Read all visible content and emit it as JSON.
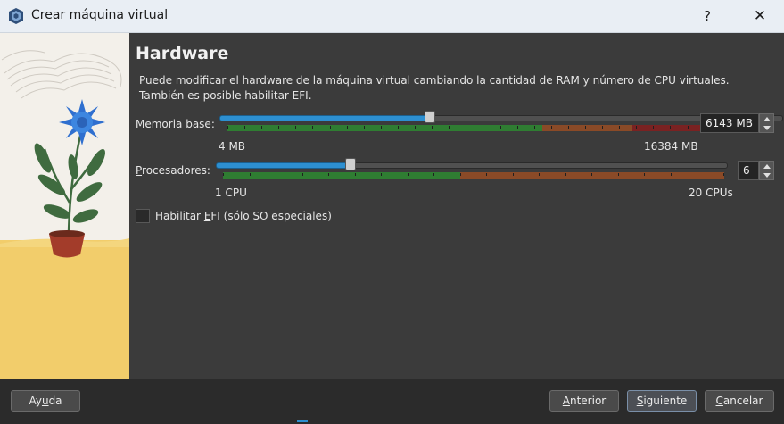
{
  "window": {
    "title": "Crear máquina virtual",
    "help": "?",
    "close": "✕"
  },
  "page": {
    "heading": "Hardware",
    "description_line1": "Puede modificar el hardware de la máquina virtual cambiando la cantidad de RAM y número de CPU virtuales.",
    "description_line2": "También es posible habilitar EFI."
  },
  "memory": {
    "label_prefix": "M",
    "label_rest": "emoria base:",
    "min_label": "4 MB",
    "max_label": "16384 MB",
    "value": "6143 MB",
    "value_mb": 6143,
    "min_mb": 4,
    "max_mb": 16384
  },
  "processors": {
    "label_prefix": "P",
    "label_rest": "rocesadores:",
    "min_label": "1 CPU",
    "max_label": "20 CPUs",
    "value": "6",
    "value_num": 6,
    "min": 1,
    "max": 20
  },
  "efi": {
    "label_pre": "Habilitar ",
    "label_u": "E",
    "label_post": "FI (sólo SO especiales)",
    "checked": false
  },
  "footer": {
    "help_pre": "Ay",
    "help_u": "u",
    "help_post": "da",
    "back_pre": "",
    "back_u": "A",
    "back_post": "nterior",
    "next_pre": "",
    "next_u": "S",
    "next_post": "iguiente",
    "cancel_pre": "",
    "cancel_u": "C",
    "cancel_post": "ancelar"
  },
  "colors": {
    "green": "#2f7d32",
    "orange": "#8a4a27",
    "red": "#7a2222",
    "accent": "#2d8fd0"
  }
}
